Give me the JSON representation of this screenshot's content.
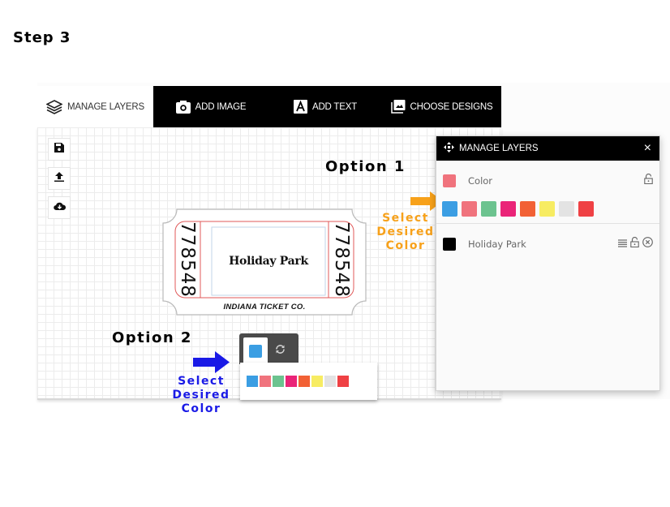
{
  "step_title": "Step 3",
  "tabs": [
    {
      "label": "MANAGE LAYERS",
      "icon": "layers-icon",
      "active": true
    },
    {
      "label": "ADD IMAGE",
      "icon": "camera-icon",
      "active": false
    },
    {
      "label": "ADD TEXT",
      "icon": "text-icon",
      "active": false
    },
    {
      "label": "CHOOSE DESIGNS",
      "icon": "image-gallery-icon",
      "active": false
    }
  ],
  "side_toolbar": [
    {
      "name": "save",
      "icon": "floppy-disk-icon"
    },
    {
      "name": "upload",
      "icon": "upload-icon"
    },
    {
      "name": "download",
      "icon": "cloud-download-icon"
    }
  ],
  "ticket": {
    "number": "778548",
    "title": "Holiday Park",
    "footer": "INDIANA TICKET CO."
  },
  "annotations": {
    "option1": "Option 1",
    "option2": "Option 2",
    "select_color_1": [
      "Select",
      "Desired",
      "Color"
    ],
    "select_color_2": [
      "Select",
      "Desired",
      "Color"
    ],
    "orange": "#f7a11a",
    "blue": "#1a1ae6"
  },
  "layers_panel": {
    "title": "MANAGE LAYERS",
    "close": "×",
    "layers": [
      {
        "name": "Color",
        "swatch": "#f0737d",
        "locked": false
      },
      {
        "name": "Holiday Park",
        "swatch": "#000000",
        "locked": false
      }
    ],
    "palette": [
      "#3b9ee3",
      "#f0737d",
      "#6cc38f",
      "#ea2478",
      "#f26135",
      "#f7ec62",
      "#e3e3e3",
      "#ef4144"
    ]
  },
  "color_control": {
    "selected": "#3b9ee3",
    "palette": [
      "#3b9ee3",
      "#f0737d",
      "#6cc38f",
      "#ea2478",
      "#f26135",
      "#f7ec62",
      "#e3e3e3",
      "#ef4144"
    ]
  }
}
